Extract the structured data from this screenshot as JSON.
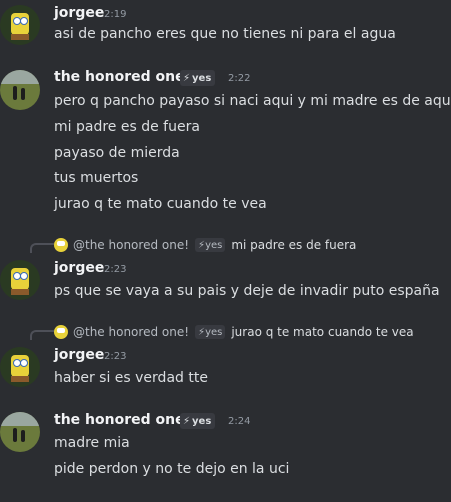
{
  "messages": [
    {
      "author": "jorgee",
      "time": "2:19",
      "lines": [
        "asi de pancho eres que no tienes ni para el agua"
      ]
    },
    {
      "author": "the honored one!",
      "badge": "yes",
      "time": "2:22",
      "lines": [
        "pero q pancho payaso si naci aqui y mi madre es de aqui",
        "mi padre es de fuera",
        "payaso de mierda",
        "tus muertos",
        "jurao q te mato cuando te vea"
      ]
    },
    {
      "reply": {
        "name": "@the honored one!",
        "badge": "yes",
        "text": "mi padre es de fuera"
      },
      "author": "jorgee",
      "time": "2:23",
      "lines": [
        "ps que se vaya a su pais y deje de invadir puto españa"
      ]
    },
    {
      "reply": {
        "name": "@the honored one!",
        "badge": "yes",
        "text": "jurao q te mato cuando te vea"
      },
      "author": "jorgee",
      "time": "2:23",
      "lines": [
        "haber si es verdad tte"
      ]
    },
    {
      "author": "the honored one!",
      "badge": "yes",
      "time": "2:24",
      "lines": [
        "madre mia",
        "pide perdon y no te dejo en la uci"
      ]
    }
  ],
  "colors": {
    "background": "#2b2d31",
    "text": "#dbdee1",
    "username": "#f2f3f5",
    "timestamp": "#949ba4"
  }
}
